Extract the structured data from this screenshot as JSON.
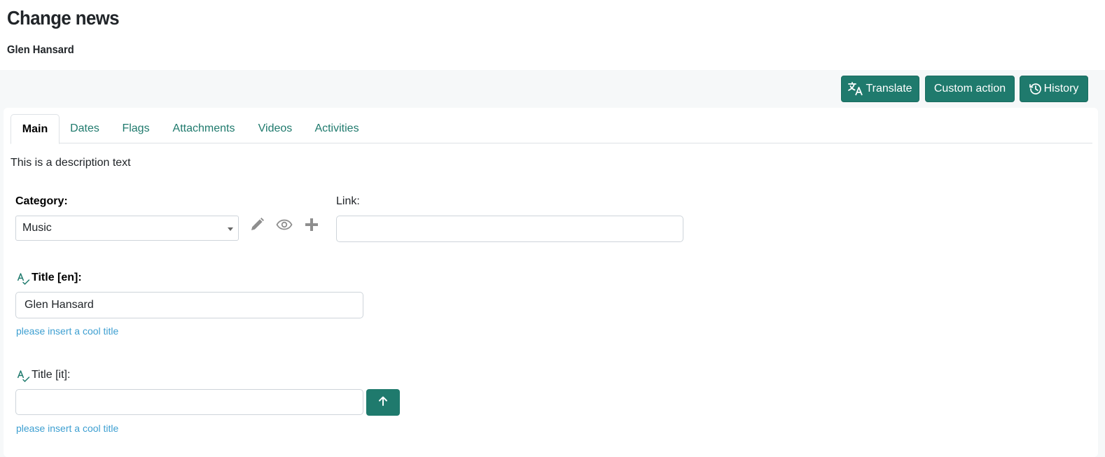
{
  "header": {
    "title": "Change news",
    "subtitle": "Glen Hansard"
  },
  "toolbar": {
    "translate_label": "Translate",
    "custom_action_label": "Custom action",
    "history_label": "History"
  },
  "tabs": [
    {
      "label": "Main",
      "active": true
    },
    {
      "label": "Dates",
      "active": false
    },
    {
      "label": "Flags",
      "active": false
    },
    {
      "label": "Attachments",
      "active": false
    },
    {
      "label": "Videos",
      "active": false
    },
    {
      "label": "Activities",
      "active": false
    }
  ],
  "main": {
    "description": "This is a description text",
    "category": {
      "label": "Category:",
      "selected": "Music",
      "icons": [
        "pencil-icon",
        "eye-icon",
        "plus-icon"
      ]
    },
    "link": {
      "label": "Link:",
      "value": ""
    },
    "title_en": {
      "label": "Title [en]:",
      "value": "Glen Hansard",
      "help": "please insert a cool title"
    },
    "title_it": {
      "label": "Title [it]:",
      "value": "",
      "help": "please insert a cool title"
    }
  },
  "colors": {
    "accent": "#1f7a6d",
    "help_text": "#3d9fd1",
    "toolbar_bg": "#f6f8f9"
  }
}
